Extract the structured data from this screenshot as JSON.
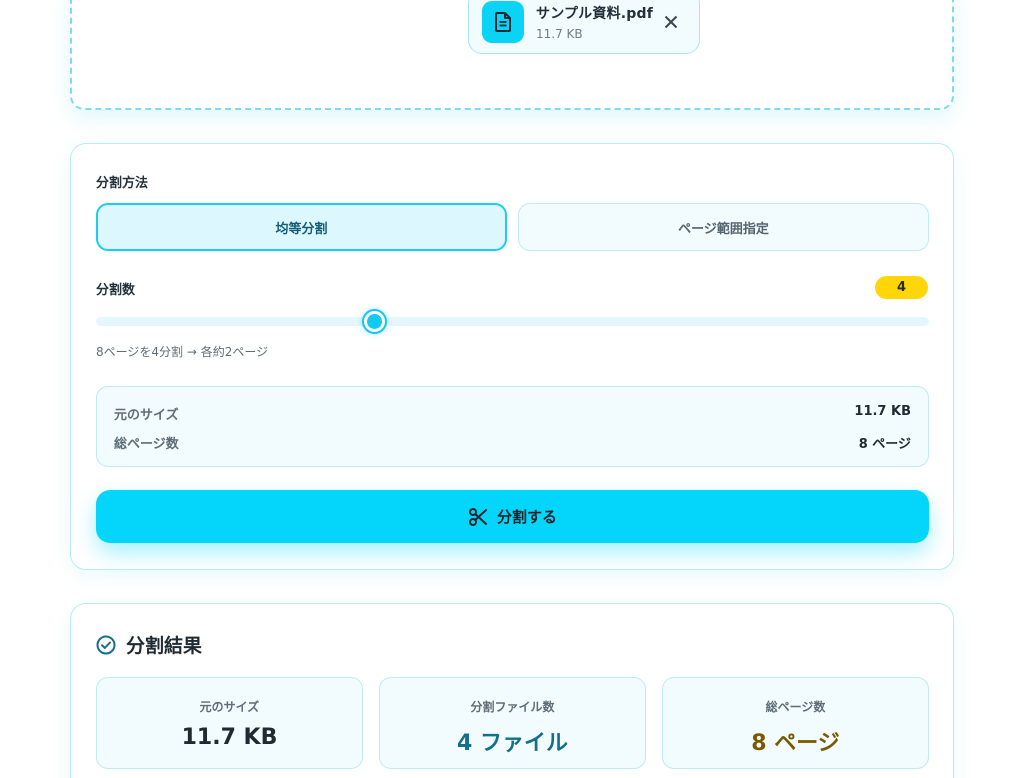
{
  "upload": {
    "file_name": "サンプル資料.pdf",
    "file_size": "11.7 KB",
    "file_icon": "document-icon",
    "close_icon": "close-icon"
  },
  "settings": {
    "method_label": "分割方法",
    "methods": [
      {
        "label": "均等分割",
        "selected": true
      },
      {
        "label": "ページ範囲指定",
        "selected": false
      }
    ],
    "count_label": "分割数",
    "count_value": "4",
    "slider": {
      "min": 2,
      "max": 8,
      "value": 4
    },
    "split_note": "8ページを4分割 → 各約2ページ",
    "info": {
      "original_size_label": "元のサイズ",
      "original_size_value": "11.7 KB",
      "total_pages_label": "総ページ数",
      "total_pages_value": "8 ページ"
    },
    "split_button_label": "分割する",
    "split_button_icon": "scissors-icon"
  },
  "results": {
    "title": "分割結果",
    "title_icon": "check-circle-icon",
    "stats": [
      {
        "label": "元のサイズ",
        "value": "11.7 KB",
        "color": "#1f2a33"
      },
      {
        "label": "分割ファイル数",
        "value": "4 ファイル",
        "color": "#137089"
      },
      {
        "label": "総ページ数",
        "value": "8 ページ",
        "color": "#7a5a00"
      }
    ]
  },
  "colors": {
    "accent": "#04d6fb",
    "accent_border": "#1fcbef",
    "badge": "#ffd60a"
  }
}
